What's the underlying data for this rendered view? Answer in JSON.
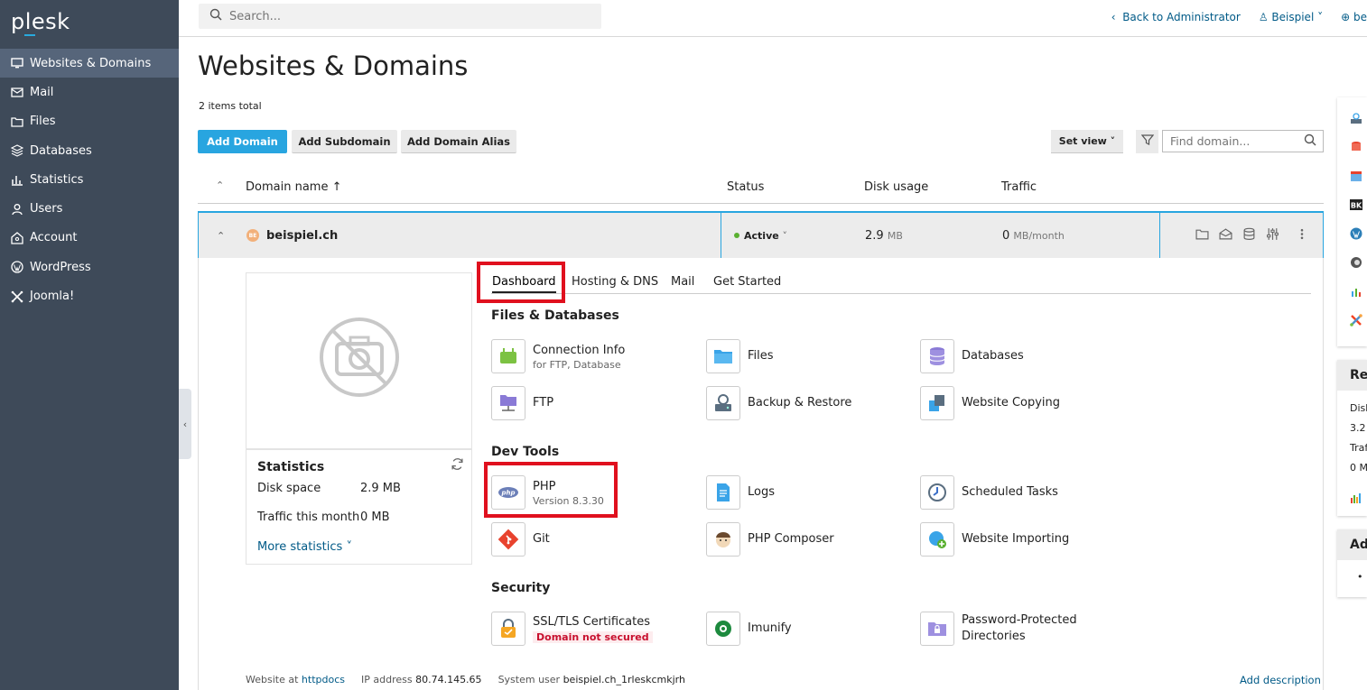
{
  "app": {
    "logo": "plesk"
  },
  "sidebar": {
    "items": [
      {
        "label": "Websites & Domains",
        "icon": "monitor-icon",
        "active": true
      },
      {
        "label": "Mail",
        "icon": "mail-icon"
      },
      {
        "label": "Files",
        "icon": "folder-icon"
      },
      {
        "label": "Databases",
        "icon": "database-icon"
      },
      {
        "label": "Statistics",
        "icon": "bar-chart-icon"
      },
      {
        "label": "Users",
        "icon": "user-icon"
      },
      {
        "label": "Account",
        "icon": "account-icon"
      },
      {
        "label": "WordPress",
        "icon": "wordpress-icon"
      },
      {
        "label": "Joomla!",
        "icon": "joomla-icon"
      }
    ]
  },
  "topbar": {
    "search_placeholder": "Search...",
    "back_link": "Back to Administrator",
    "user": "Beispiel",
    "lang": "be"
  },
  "page": {
    "title": "Websites & Domains",
    "items_total": "2 items total",
    "buttons": {
      "add_domain": "Add Domain",
      "add_subdomain": "Add Subdomain",
      "add_alias": "Add Domain Alias"
    },
    "set_view": "Set view",
    "find_placeholder": "Find domain..."
  },
  "table": {
    "columns": {
      "domain": "Domain name ↑",
      "status": "Status",
      "disk": "Disk usage",
      "traffic": "Traffic"
    },
    "row": {
      "domain": "beispiel.ch",
      "favicon_text": "BE",
      "status": "Active",
      "disk_value": "2.9",
      "disk_unit": "MB",
      "traffic_value": "0",
      "traffic_unit": "MB/month"
    }
  },
  "stats": {
    "title": "Statistics",
    "disk_label": "Disk space",
    "disk_value": "2.9 MB",
    "traffic_label": "Traffic this month",
    "traffic_value": "0 MB",
    "more": "More statistics"
  },
  "tabs": [
    "Dashboard",
    "Hosting & DNS",
    "Mail",
    "Get Started"
  ],
  "sections": {
    "files_db": "Files & Databases",
    "dev": "Dev Tools",
    "security": "Security"
  },
  "tools": {
    "connection": {
      "label": "Connection Info",
      "sub": "for FTP, Database"
    },
    "files": {
      "label": "Files"
    },
    "databases": {
      "label": "Databases"
    },
    "ftp": {
      "label": "FTP"
    },
    "backup": {
      "label": "Backup & Restore"
    },
    "copying": {
      "label": "Website Copying"
    },
    "php": {
      "label": "PHP",
      "sub": "Version 8.3.30"
    },
    "logs": {
      "label": "Logs"
    },
    "tasks": {
      "label": "Scheduled Tasks"
    },
    "git": {
      "label": "Git"
    },
    "composer": {
      "label": "PHP Composer"
    },
    "importing": {
      "label": "Website Importing"
    },
    "ssl": {
      "label": "SSL/TLS Certificates",
      "warn": "Domain not secured"
    },
    "imunify": {
      "label": "Imunify"
    },
    "pwprot": {
      "label": "Password-Protected",
      "label2": "Directories"
    }
  },
  "footer": {
    "website_at_label": "Website at",
    "website_at_link": "httpdocs",
    "ip_label": "IP address",
    "ip_value": "80.74.145.65",
    "sysuser_label": "System user",
    "sysuser_value": "beispiel.ch_1rleskcmkjrh",
    "add_description": "Add description"
  },
  "rail": {
    "card1_title": "Res",
    "card1_lines": [
      "Disk",
      "3.2",
      "Traf",
      "0 M"
    ],
    "card2_title": "Ad",
    "card2_bullet": "•"
  },
  "colors": {
    "accent": "#28a5e0",
    "sidebar": "#3e4a59",
    "highlight": "#e0101e"
  }
}
